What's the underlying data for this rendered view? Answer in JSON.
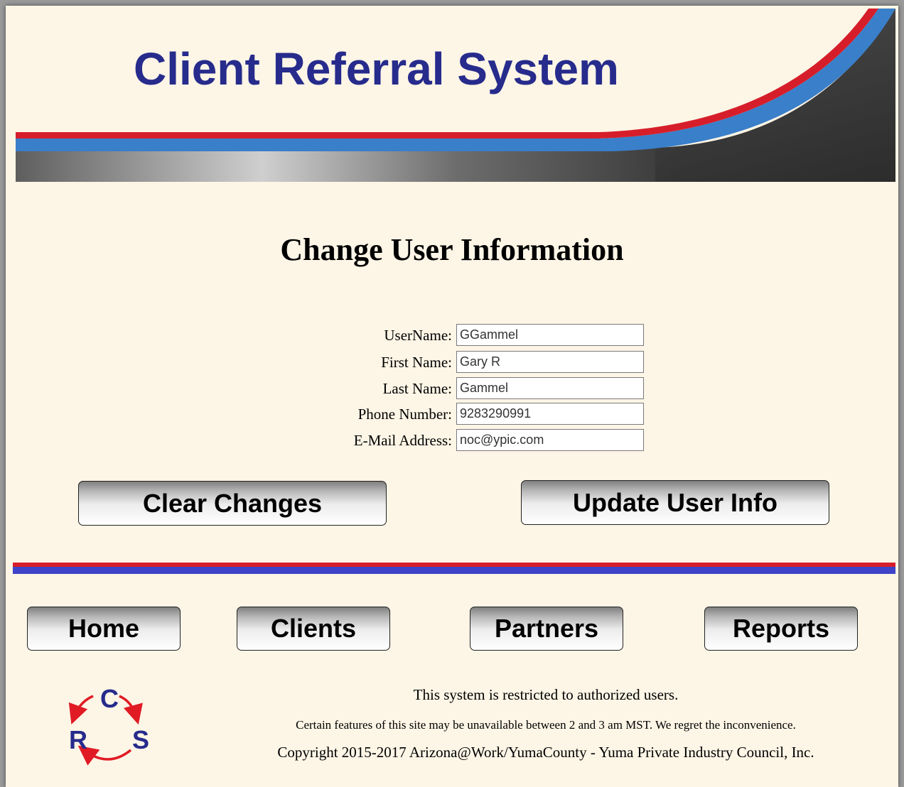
{
  "header": {
    "title": "Client Referral System"
  },
  "page": {
    "title": "Change User Information"
  },
  "form": {
    "fields": [
      {
        "label": "UserName:",
        "value": "GGammel"
      },
      {
        "label": "First Name:",
        "value": "Gary R"
      },
      {
        "label": "Last Name:",
        "value": "Gammel"
      },
      {
        "label": "Phone Number:",
        "value": "9283290991"
      },
      {
        "label": "E-Mail Address:",
        "value": "noc@ypic.com"
      }
    ]
  },
  "actions": {
    "clear_label": "Clear Changes",
    "update_label": "Update User Info"
  },
  "nav": {
    "items": [
      {
        "label": "Home"
      },
      {
        "label": "Clients"
      },
      {
        "label": "Partners"
      },
      {
        "label": "Reports"
      }
    ]
  },
  "logo": {
    "letters": [
      "C",
      "R",
      "S"
    ],
    "icon": "crs-cycle-logo"
  },
  "footer": {
    "restricted": "This system is restricted to authorized users.",
    "maintenance": "Certain features of this site may be unavailable between 2 and 3 am MST. We regret the inconvenience.",
    "copyright": "Copyright 2015-2017 Arizona@Work/YumaCounty - Yuma Private Industry Council, Inc."
  },
  "colors": {
    "background": "#FDF5E6",
    "title_blue": "#262B8C",
    "stripe_red": "#D61E2A",
    "stripe_blue": "#3E43C8",
    "banner_blue": "#3A7FC9"
  }
}
